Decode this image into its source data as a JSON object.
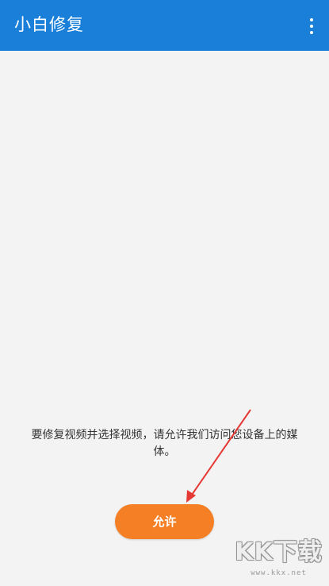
{
  "app_bar": {
    "title": "小白修复",
    "menu_icon": "more-vertical-icon",
    "background_color": "#1a7fd8"
  },
  "permission": {
    "message": "要修复视频并选择视频，请允许我们访问您设备上的媒体。",
    "allow_label": "允许",
    "button_color": "#f57f24"
  },
  "annotation": {
    "arrow_color": "#e53935"
  },
  "watermark": {
    "text": "KK下载",
    "url": "www.kkx.net"
  }
}
